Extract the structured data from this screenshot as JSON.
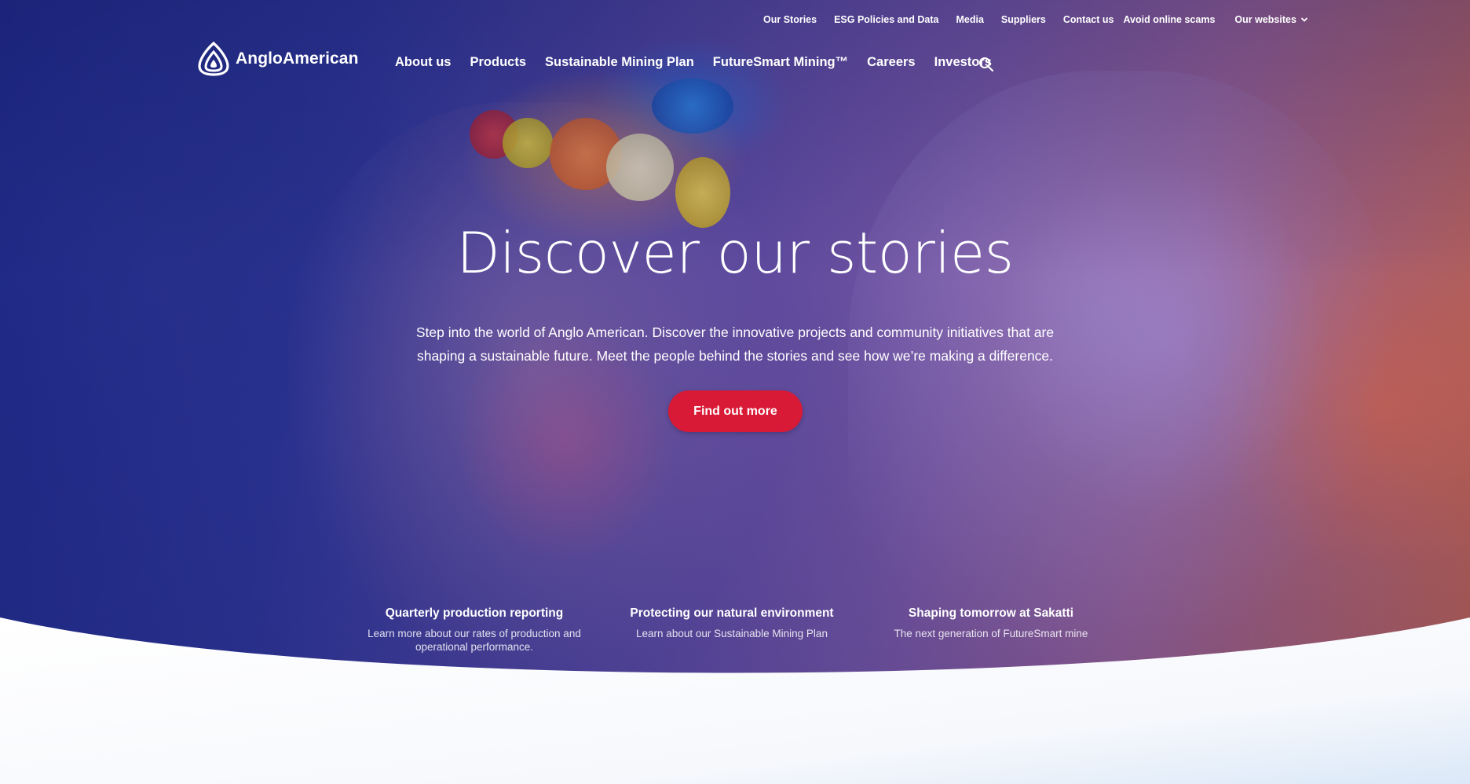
{
  "utility_nav": {
    "items": [
      {
        "label": "Our Stories"
      },
      {
        "label": "ESG Policies and Data"
      },
      {
        "label": "Media"
      },
      {
        "label": "Suppliers"
      },
      {
        "label": "Contact us"
      },
      {
        "label": "Avoid online scams"
      }
    ],
    "websites_label": "Our websites"
  },
  "brand": {
    "name": "AngloAmerican"
  },
  "main_nav": {
    "items": [
      {
        "label": "About us"
      },
      {
        "label": "Products"
      },
      {
        "label": "Sustainable Mining Plan"
      },
      {
        "label": "FutureSmart Mining™"
      },
      {
        "label": "Careers"
      },
      {
        "label": "Investors"
      }
    ],
    "search_icon": "search-icon"
  },
  "hero": {
    "title": "Discover our stories",
    "description": "Step into the world of Anglo American. Discover the innovative projects and community initiatives that are shaping a sustainable future. Meet the people behind the stories and see how we’re making a difference.",
    "cta_label": "Find out more"
  },
  "features": [
    {
      "title": "Quarterly production reporting",
      "description": "Learn more about our rates of production and operational performance."
    },
    {
      "title": "Protecting our natural environment",
      "description": "Learn about our Sustainable Mining Plan"
    },
    {
      "title": "Shaping tomorrow at Sakatti",
      "description": "The next generation of FutureSmart mine"
    }
  ],
  "colors": {
    "cta": "#d91a36",
    "hero_overlay_start": "#1f2a8a",
    "hero_overlay_end": "#c9664f",
    "background": "#f3f6fb"
  }
}
